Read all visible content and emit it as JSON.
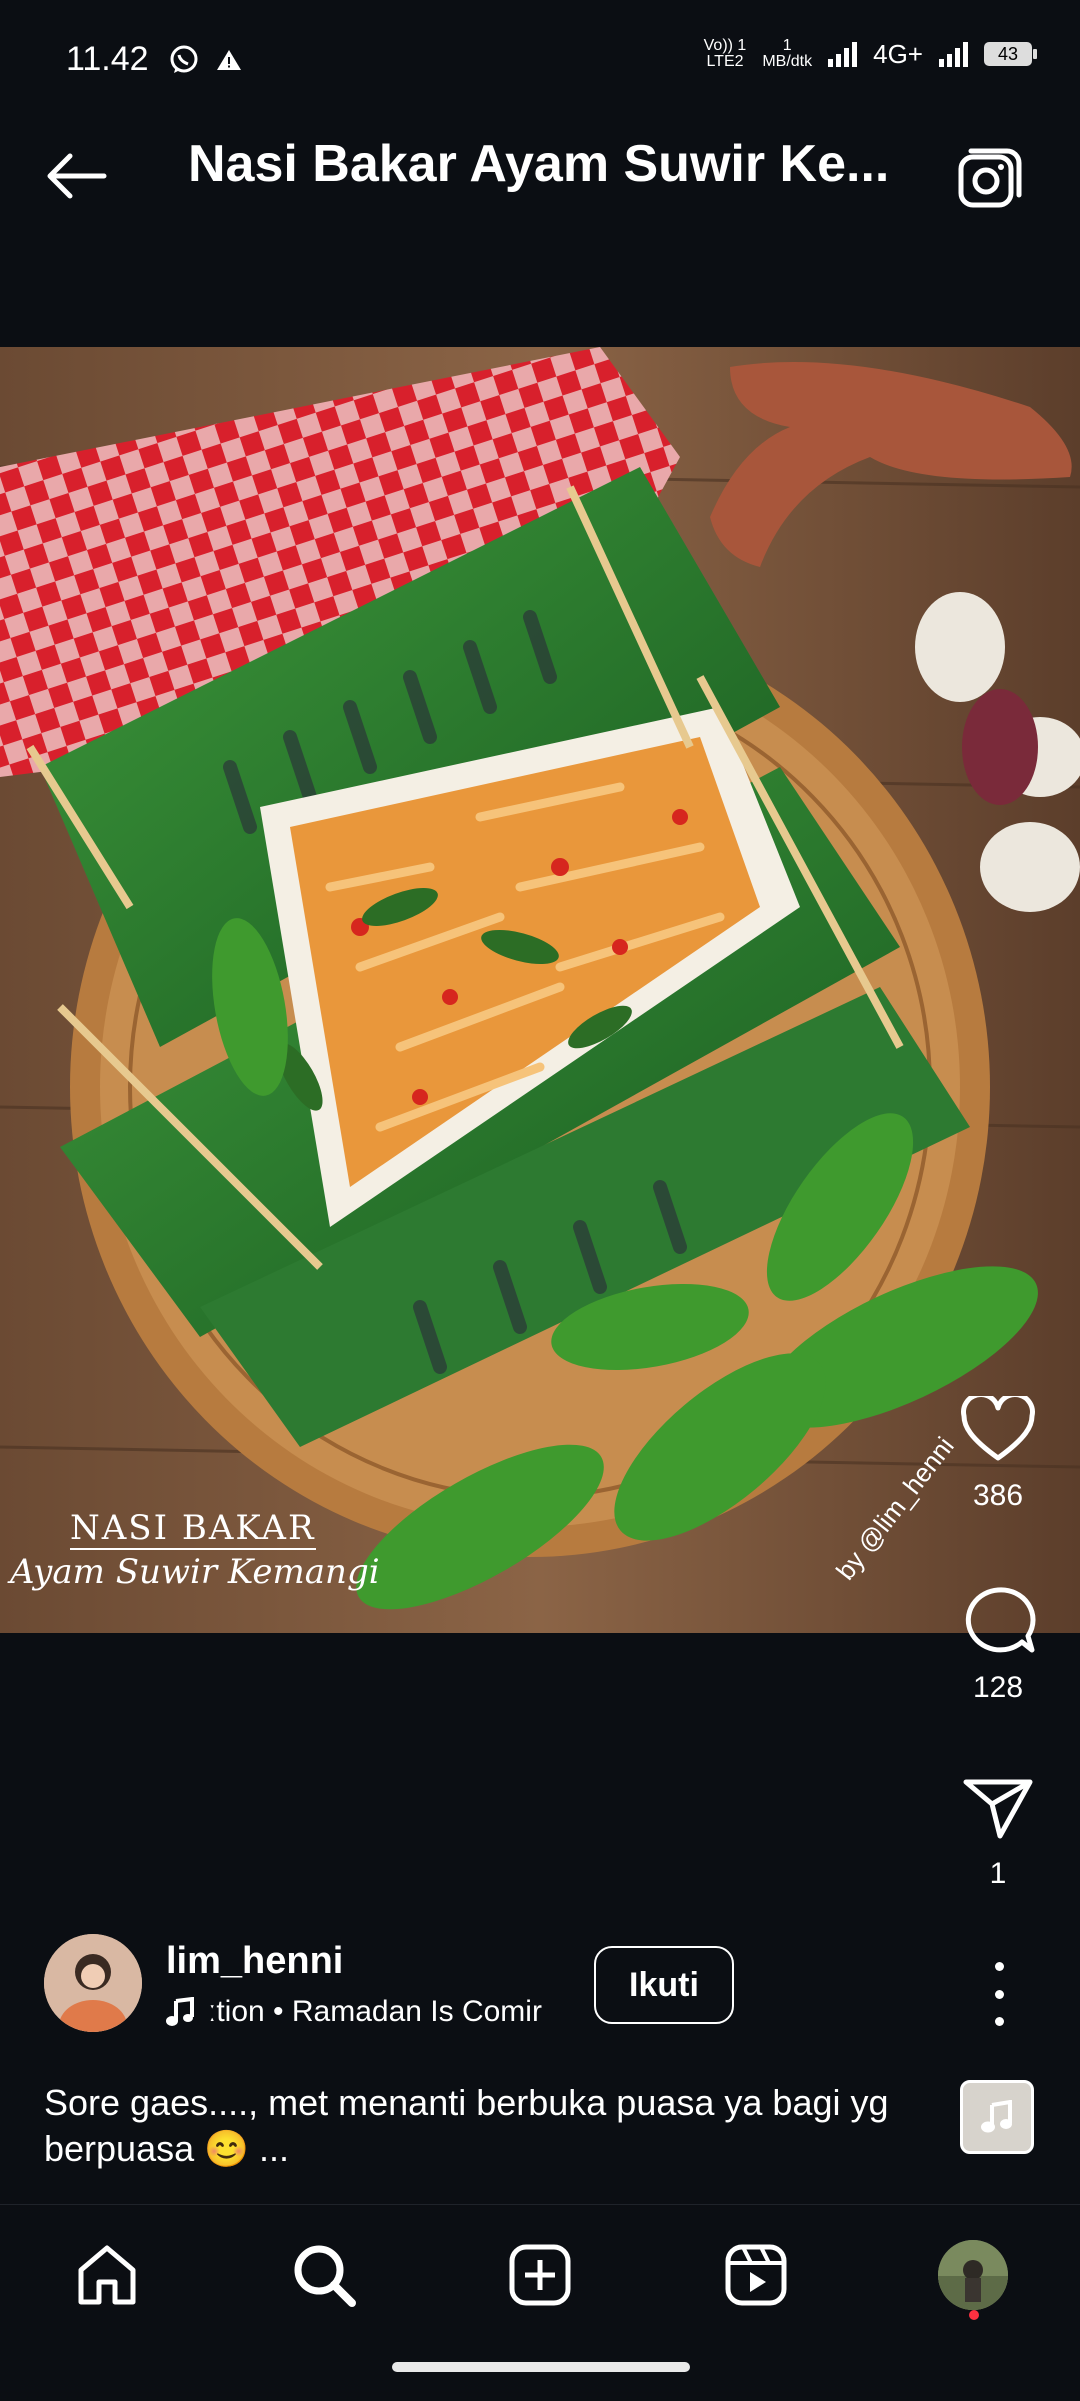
{
  "status_bar": {
    "time": "11.42",
    "network_volte": "Vo)) 1",
    "network_lte": "LTE2",
    "speed_value": "1",
    "speed_unit": "MB/dtk",
    "network_type": "4G+",
    "battery": "43"
  },
  "header": {
    "title": "Nasi Bakar Ayam Suwir Ke..."
  },
  "photo": {
    "caption_line1": "NASI BAKAR",
    "caption_line2": "Ayam Suwir Kemangi",
    "credit": "by @lim_henni"
  },
  "actions": {
    "likes": "386",
    "comments": "128",
    "shares": "1"
  },
  "author": {
    "username": "lim_henni",
    "audio_text": "ːtion • Ramadan Is Comir",
    "follow_label": "Ikuti"
  },
  "caption": {
    "text": "Sore gaes...., met menanti berbuka puasa ya bagi yg berpuasa 😊 ..."
  },
  "colors": {
    "background": "#0b0e13",
    "text": "#ffffff",
    "notification_dot": "#ff3040"
  }
}
